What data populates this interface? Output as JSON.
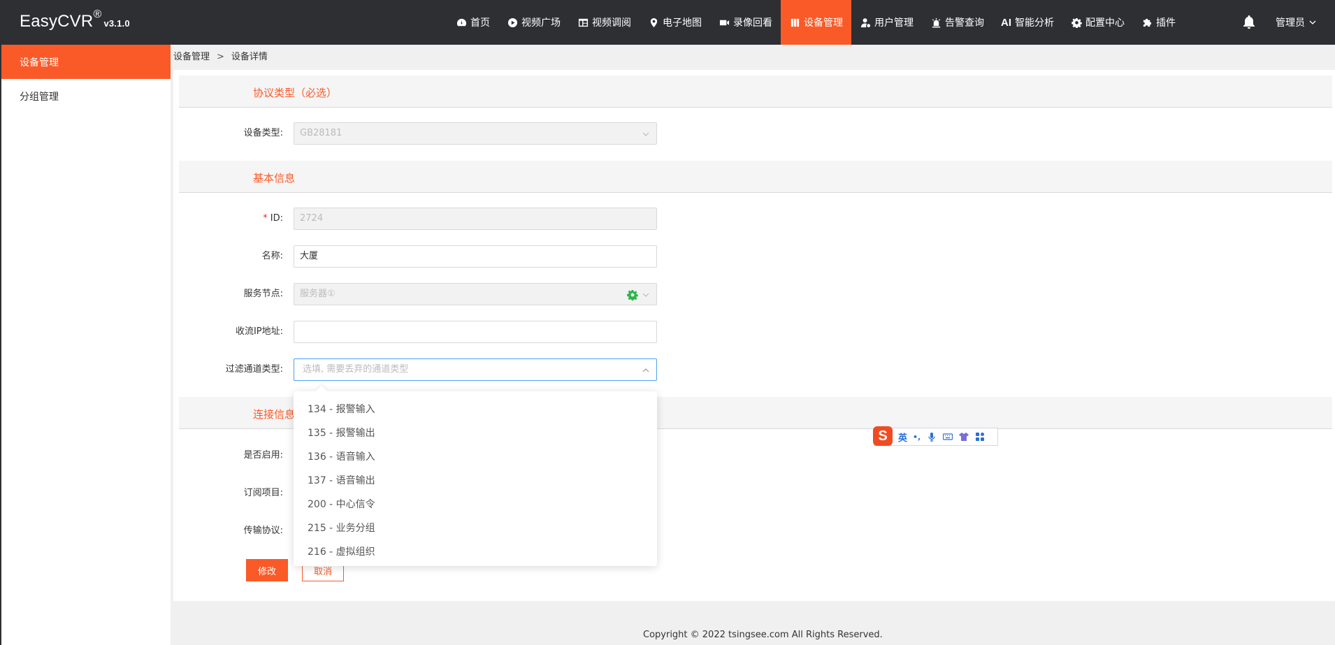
{
  "app": {
    "name": "EasyCVR",
    "reg": "®",
    "version": "v3.1.0"
  },
  "nav": [
    {
      "label": "首页",
      "icon": "dashboard-icon"
    },
    {
      "label": "视频广场",
      "icon": "play-circle-icon"
    },
    {
      "label": "视频调阅",
      "icon": "grid-layout-icon"
    },
    {
      "label": "电子地图",
      "icon": "map-pin-icon"
    },
    {
      "label": "录像回看",
      "icon": "video-camera-icon"
    },
    {
      "label": "设备管理",
      "icon": "device-columns-icon",
      "active": true
    },
    {
      "label": "用户管理",
      "icon": "user-gear-icon"
    },
    {
      "label": "告警查询",
      "icon": "alarm-light-icon"
    },
    {
      "label": "智能分析",
      "icon": "ai-text-icon",
      "prefix": "AI"
    },
    {
      "label": "配置中心",
      "icon": "gear-icon"
    },
    {
      "label": "插件",
      "icon": "puzzle-icon"
    }
  ],
  "user": {
    "label": "管理员"
  },
  "sidebar": {
    "items": [
      {
        "label": "设备管理",
        "active": true
      },
      {
        "label": "分组管理"
      }
    ]
  },
  "breadcrumb": {
    "parent": "设备管理",
    "sep": ">",
    "current": "设备详情"
  },
  "sections": {
    "protocol": "协议类型（必选）",
    "basic": "基本信息",
    "connect": "连接信息"
  },
  "form": {
    "device_type": {
      "label": "设备类型:",
      "value": "GB28181"
    },
    "id": {
      "required_mark": "*",
      "label": "ID:",
      "value": "2724"
    },
    "name": {
      "label": "名称:",
      "value": "大厦"
    },
    "service_node": {
      "label": "服务节点:",
      "value": "服务器①"
    },
    "stream_ip": {
      "label": "收流IP地址:",
      "value": ""
    },
    "filter_channel": {
      "label": "过滤通道类型:",
      "placeholder": "选填, 需要丢弃的通道类型"
    },
    "enabled": {
      "label": "是否启用:"
    },
    "subscribe": {
      "label": "订阅项目:"
    },
    "transport": {
      "label": "传输协议:"
    }
  },
  "dropdown": {
    "options": [
      "134 - 报警输入",
      "135 - 报警输出",
      "136 - 语音输入",
      "137 - 语音输出",
      "200 - 中心信令",
      "215 - 业务分组",
      "216 - 虚拟组织"
    ]
  },
  "buttons": {
    "save": "修改",
    "cancel": "取消"
  },
  "ime": {
    "lang": "英",
    "punct": "•,"
  },
  "footer": "Copyright © 2022 tsingsee.com All Rights Reserved.",
  "colors": {
    "accent": "#fa5a28",
    "topbar": "#2d2f33",
    "focus": "#4ba1f5",
    "gear": "#2bb54a"
  }
}
